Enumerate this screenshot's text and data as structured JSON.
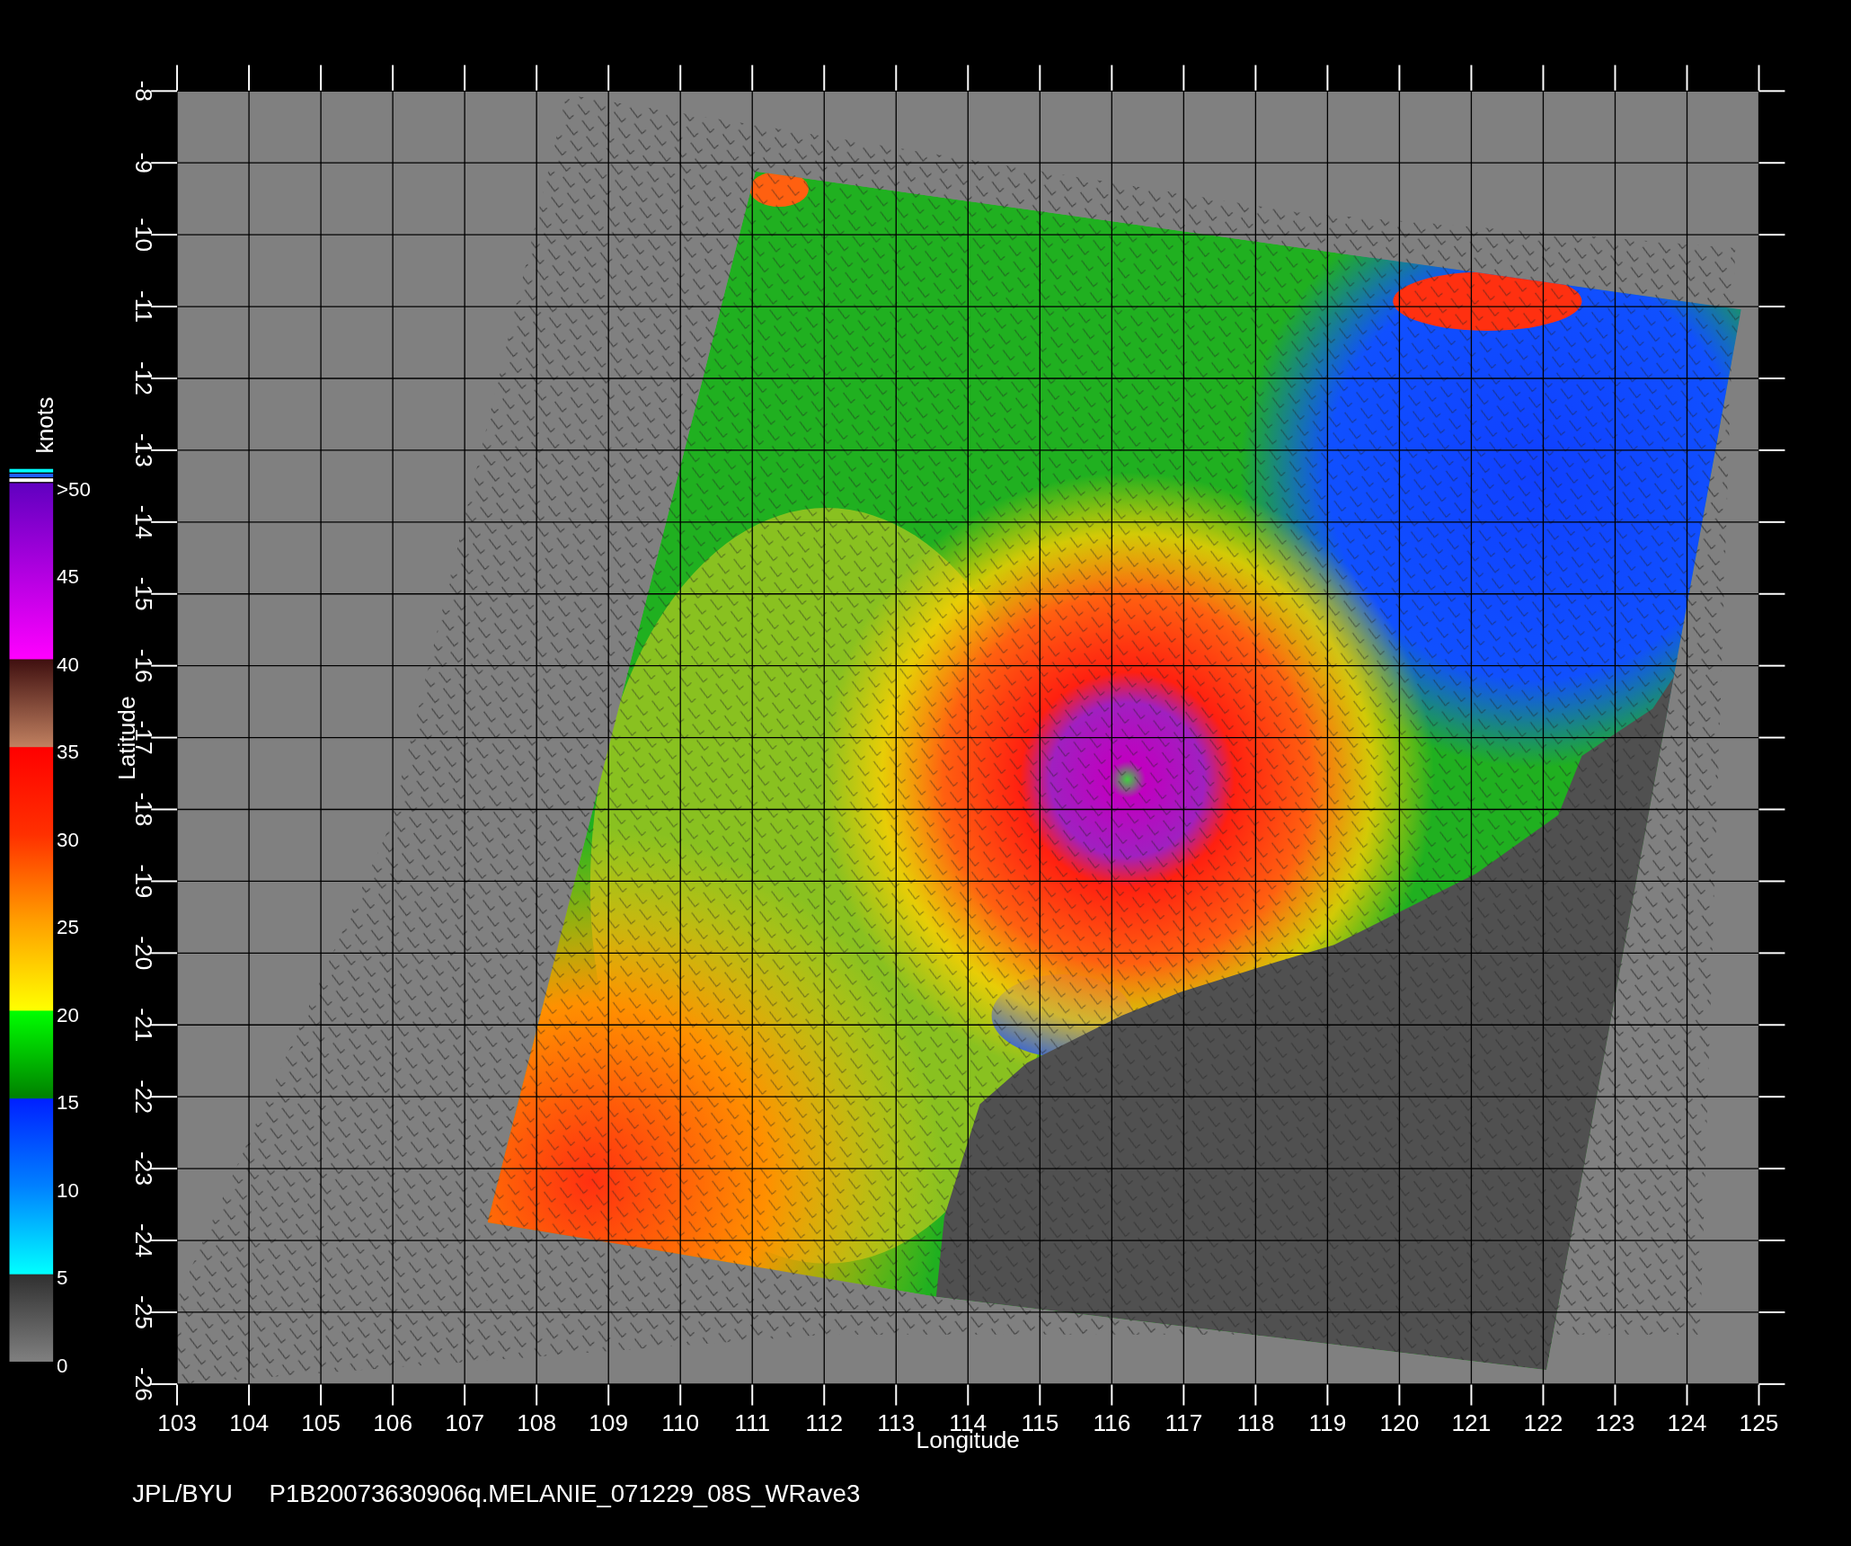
{
  "colorbar": {
    "unit": "knots",
    "labels": [
      ">50",
      "45",
      "40",
      "35",
      "30",
      "25",
      "20",
      "15",
      "10",
      "5",
      "0"
    ]
  },
  "axes": {
    "xlabel": "Longitude",
    "ylabel": "Latitude",
    "xticks": [
      "103",
      "104",
      "105",
      "106",
      "107",
      "108",
      "109",
      "110",
      "111",
      "112",
      "113",
      "114",
      "115",
      "116",
      "117",
      "118",
      "119",
      "120",
      "121",
      "122",
      "123",
      "124",
      "125"
    ],
    "yticks": [
      "-8",
      "-9",
      "-10",
      "-11",
      "-12",
      "-13",
      "-14",
      "-15",
      "-16",
      "-17",
      "-18",
      "-19",
      "-20",
      "-21",
      "-22",
      "-23",
      "-24",
      "-25",
      "-26"
    ]
  },
  "caption": {
    "source": "JPL/BYU",
    "product": "P1B20073630906q.MELANIE_071229_08S_WRave3"
  }
}
